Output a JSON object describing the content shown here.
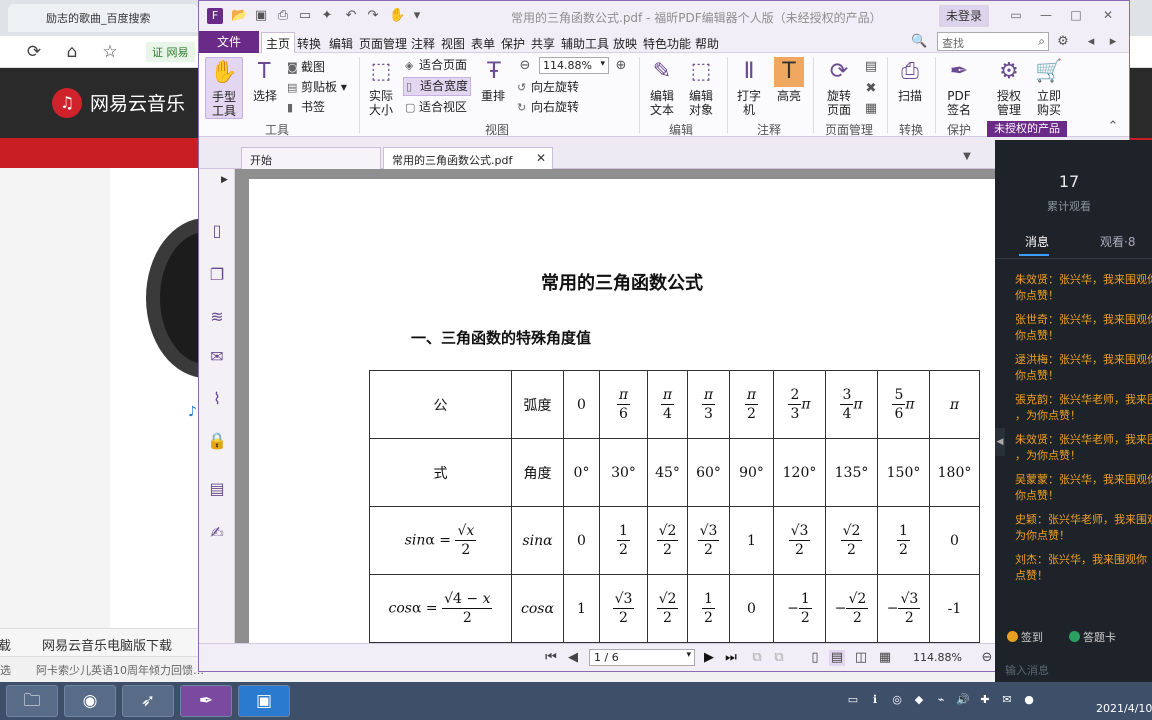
{
  "background_browser": {
    "tab_title": "励志的歌曲_百度搜索",
    "bookmark": "证 网易",
    "logo_text": "网易云音乐",
    "bottom_tab_left": "载",
    "bottom_tab_link": "网易云音乐电脑版下载",
    "status_left": "选",
    "status_news": "阿卡索少儿英语10周年倾力回馈…"
  },
  "window": {
    "title": "常用的三角函数公式.pdf - 福昕PDF编辑器个人版（未经授权的产品）",
    "login": "未登录"
  },
  "menu": {
    "file": "文件",
    "items": [
      "主页",
      "转换",
      "编辑",
      "页面管理",
      "注释",
      "视图",
      "表单",
      "保护",
      "共享",
      "辅助工具",
      "放映",
      "特色功能",
      "帮助"
    ],
    "search_placeholder": "查找"
  },
  "ribbon": {
    "hand_tool": "手型工具",
    "select": "选择",
    "snapshot": "截图",
    "clipboard": "剪贴板",
    "bookmark": "书签",
    "actual_size": "实际大小",
    "fit_page": "适合页面",
    "fit_width": "适合宽度",
    "fit_visible": "适合视区",
    "reflow": "重排",
    "zoom": "114.88%",
    "rotate_left": "向左旋转",
    "rotate_right": "向右旋转",
    "edit_text": "编辑文本",
    "edit_object": "编辑对象",
    "typewriter": "打字机",
    "highlight": "高亮",
    "rotate_page": "旋转页面",
    "scan": "扫描",
    "pdf_sign": "PDF签名",
    "auth_manage": "授权管理",
    "buy_now": "立即购买",
    "groups": {
      "tools": "工具",
      "view": "视图",
      "edit": "编辑",
      "annotate": "注释",
      "page_manage": "页面管理",
      "convert": "转换",
      "protect": "保护",
      "unauthorized": "未授权的产品"
    }
  },
  "tabs": {
    "start": "开始",
    "document": "常用的三角函数公式.pdf"
  },
  "document": {
    "title": "常用的三角函数公式",
    "heading": "一、三角函数的特殊角度值",
    "table": {
      "formula_label_1": "公",
      "formula_label_2": "式",
      "radian_label": "弧度",
      "angle_label": "角度",
      "radians": [
        "0",
        "π/6",
        "π/4",
        "π/3",
        "π/2",
        "2/3 π",
        "3/4 π",
        "5/6 π",
        "π"
      ],
      "degrees": [
        "0°",
        "30°",
        "45°",
        "60°",
        "90°",
        "120°",
        "135°",
        "150°",
        "180°"
      ],
      "sin_formula": "sinα = √x / 2",
      "sin_label": "sinα",
      "sin_values": [
        "0",
        "1/2",
        "√2/2",
        "√3/2",
        "1",
        "√3/2",
        "√2/2",
        "1/2",
        "0"
      ],
      "cos_formula": "cosα = √(4−x) / 2",
      "cos_label": "cosα",
      "cos_values": [
        "1",
        "√3/2",
        "√2/2",
        "1/2",
        "0",
        "−1/2",
        "−√2/2",
        "−√3/2",
        "-1"
      ]
    }
  },
  "statusbar": {
    "page": "1 / 6",
    "zoom": "114.88%"
  },
  "chat": {
    "viewer_count": "17",
    "viewer_label": "累计观看",
    "tab_messages": "消息",
    "tab_viewers": "观看·8",
    "messages": [
      [
        "朱效贤：张兴华，我来围观你",
        "你点赞！"
      ],
      [
        "张世奇：张兴华，我来围观你",
        "你点赞！"
      ],
      [
        "逯洪梅：张兴华，我来围观你",
        "你点赞！"
      ],
      [
        "張克韵：张兴华老师，我来围",
        "，为你点赞！"
      ],
      [
        "朱效贤：张兴华老师，我来围",
        "，为你点赞！"
      ],
      [
        "吴蒙蒙：张兴华，我来围观你",
        "你点赞！"
      ],
      [
        "史颖：张兴华老师，我来围观",
        "为你点赞！"
      ],
      [
        "刘杰：张兴华，我来围观你",
        "点赞！"
      ]
    ],
    "checkin": "签到",
    "answer_card": "答题卡",
    "input_placeholder": "输入消息"
  },
  "taskbar": {
    "clock": "2021/4/10"
  }
}
